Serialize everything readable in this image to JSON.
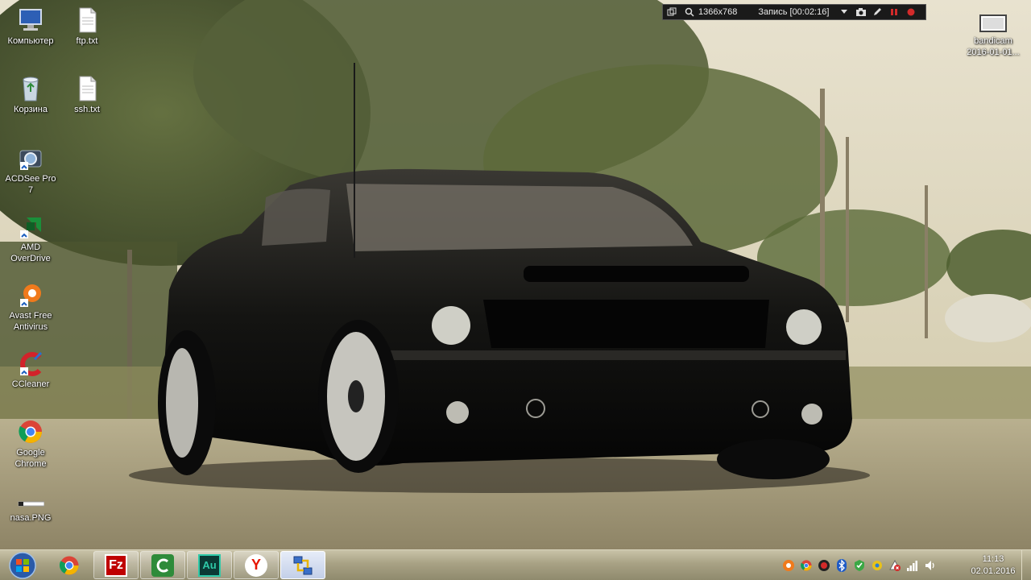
{
  "desktop": {
    "icons": [
      {
        "label": "Компьютер",
        "icon": "computer-icon"
      },
      {
        "label": "ftp.txt",
        "icon": "text-file-icon"
      },
      {
        "label": "Корзина",
        "icon": "recycle-bin-icon"
      },
      {
        "label": "ssh.txt",
        "icon": "text-file-icon"
      },
      {
        "label": "ACDSee Pro 7",
        "icon": "acdsee-icon"
      },
      {
        "label": "AMD OverDrive",
        "icon": "amd-overdrive-icon"
      },
      {
        "label": "Avast Free Antivirus",
        "icon": "avast-icon"
      },
      {
        "label": "CCleaner",
        "icon": "ccleaner-icon"
      },
      {
        "label": "Google Chrome",
        "icon": "chrome-icon"
      },
      {
        "label": "nasa.PNG",
        "icon": "image-file-icon"
      },
      {
        "label": "bandicam 2016-01-01...",
        "icon": "video-file-icon"
      }
    ]
  },
  "bandicam": {
    "resolution": "1366x768",
    "recording": "Запись [00:02:16]"
  },
  "taskbar": {
    "pinned": [
      "chrome-icon",
      "filezilla-icon",
      "camtasia-icon",
      "audition-icon",
      "yandex-browser-icon",
      "network-tool-icon"
    ],
    "audition_label": "Au",
    "filezilla_label": "Fz",
    "yandex_label": "Y"
  },
  "tray": {
    "icons": [
      "avast-tray-icon",
      "chrome-tray-icon",
      "bandicam-tray-icon",
      "bluetooth-icon",
      "shield-tray-icon",
      "settings-tray-icon",
      "action-center-icon",
      "network-icon",
      "volume-icon"
    ]
  },
  "clock": {
    "time": "11:13",
    "date": "02.01.2016"
  },
  "colors": {
    "accent_red": "#d22a2a",
    "taskbar": "#a8a184"
  }
}
